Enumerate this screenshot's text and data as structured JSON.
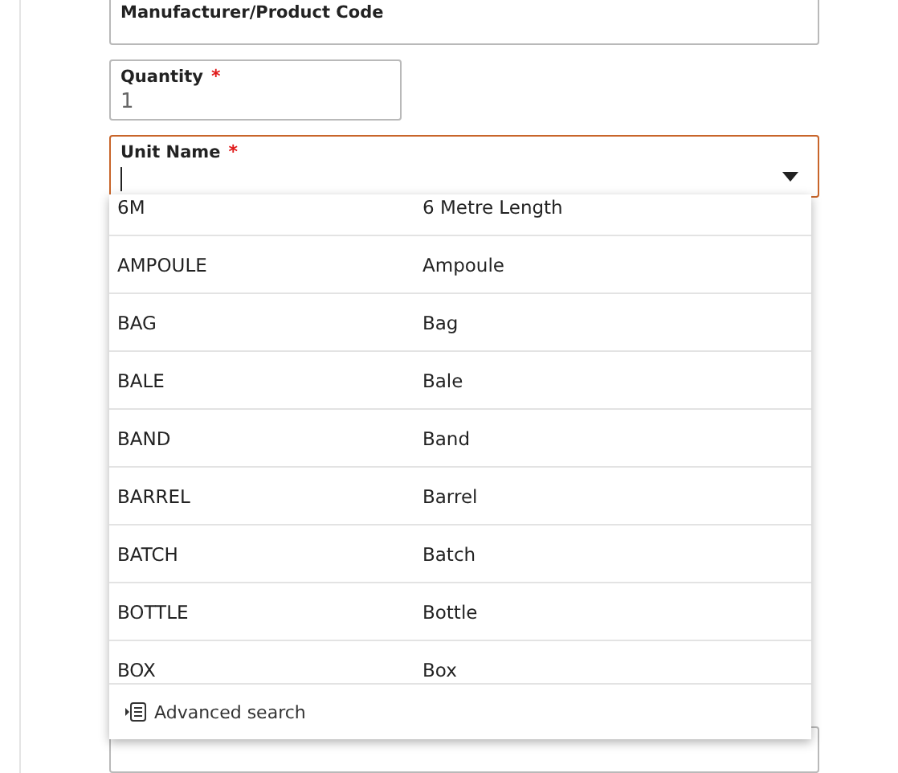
{
  "fields": [
    {
      "kind": "text",
      "label": "Manufacturer/Product Code",
      "focused": false
    },
    {
      "kind": "number",
      "label": "Quantity",
      "required_mark": "*",
      "value": "1",
      "focused": false
    },
    {
      "kind": "select",
      "label": "Unit Name",
      "required_mark": "*",
      "focused": true,
      "expanded": true
    }
  ],
  "dropdown": {
    "options": [
      {
        "code": "6M",
        "name": "6 Metre Length",
        "selected": false
      },
      {
        "code": "AMPOULE",
        "name": "Ampoule",
        "selected": false
      },
      {
        "code": "BAG",
        "name": "Bag",
        "selected": false
      },
      {
        "code": "BALE",
        "name": "Bale",
        "selected": false
      },
      {
        "code": "BAND",
        "name": "Band",
        "selected": false
      },
      {
        "code": "BARREL",
        "name": "Barrel",
        "selected": false
      },
      {
        "code": "BATCH",
        "name": "Batch",
        "selected": false
      },
      {
        "code": "BOTTLE",
        "name": "Bottle",
        "selected": false
      },
      {
        "code": "BOX",
        "name": "Box",
        "selected": false
      }
    ],
    "footer": "Advanced search"
  }
}
